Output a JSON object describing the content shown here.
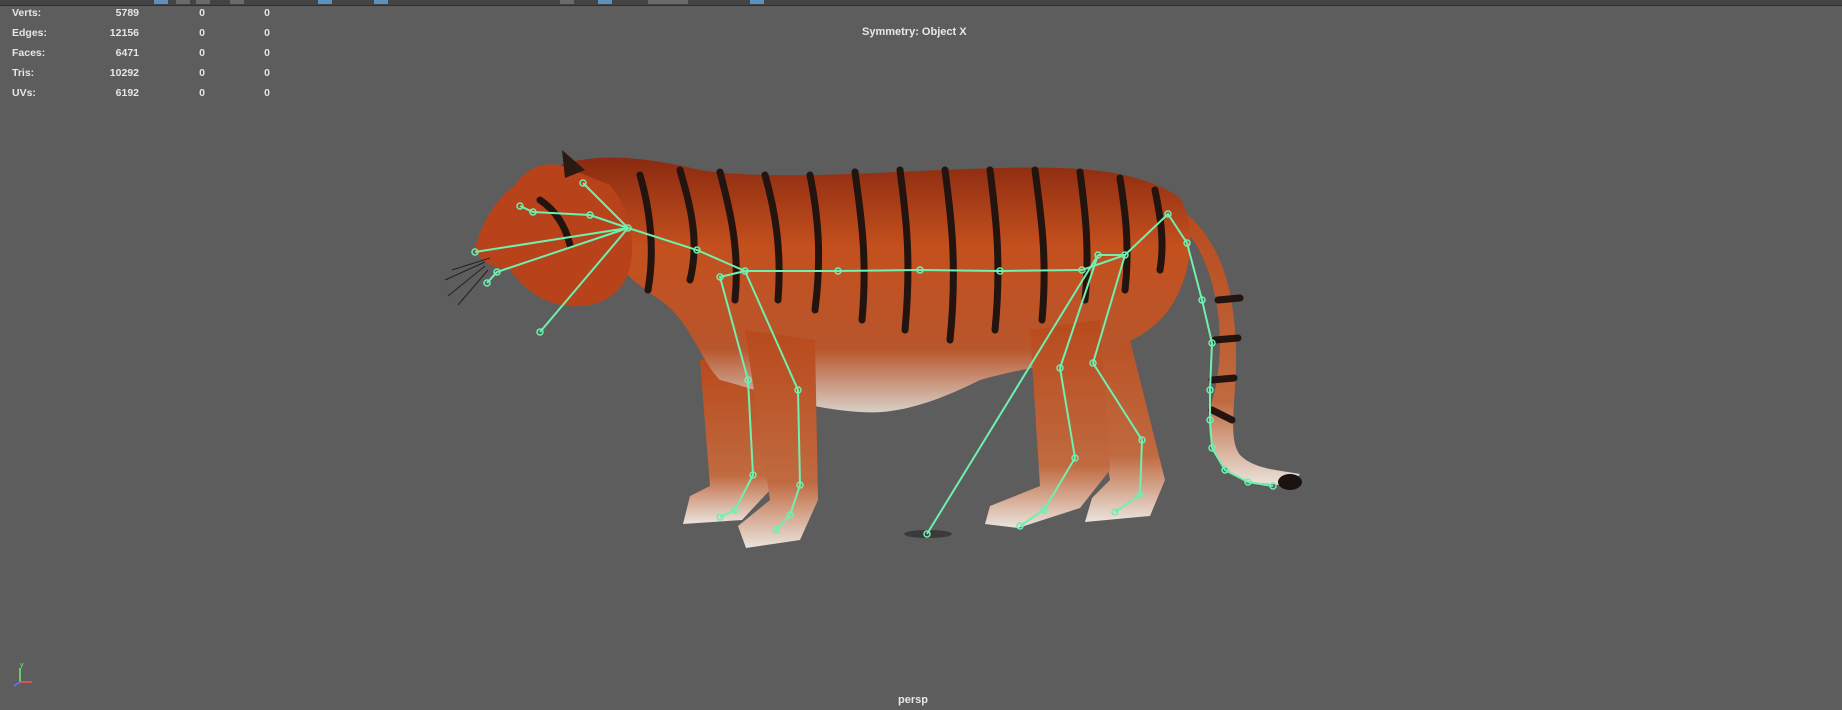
{
  "hud": {
    "rows": [
      {
        "label": "Verts:",
        "values": [
          "5789",
          "0",
          "0"
        ]
      },
      {
        "label": "Edges:",
        "values": [
          "12156",
          "0",
          "0"
        ]
      },
      {
        "label": "Faces:",
        "values": [
          "6471",
          "0",
          "0"
        ]
      },
      {
        "label": "Tris:",
        "values": [
          "10292",
          "0",
          "0"
        ]
      },
      {
        "label": "UVs:",
        "values": [
          "6192",
          "0",
          "0"
        ]
      }
    ]
  },
  "viewport": {
    "symmetry_label": "Symmetry: Object X",
    "camera_label": "persp",
    "axis": {
      "y": "y",
      "x": "x"
    }
  },
  "colors": {
    "background": "#5d5d5d",
    "joint": "#6ef0b0",
    "tiger_orange": "#c44a1c"
  },
  "icons": [
    "axis-gizmo-icon",
    "skeleton-joint-icon"
  ]
}
